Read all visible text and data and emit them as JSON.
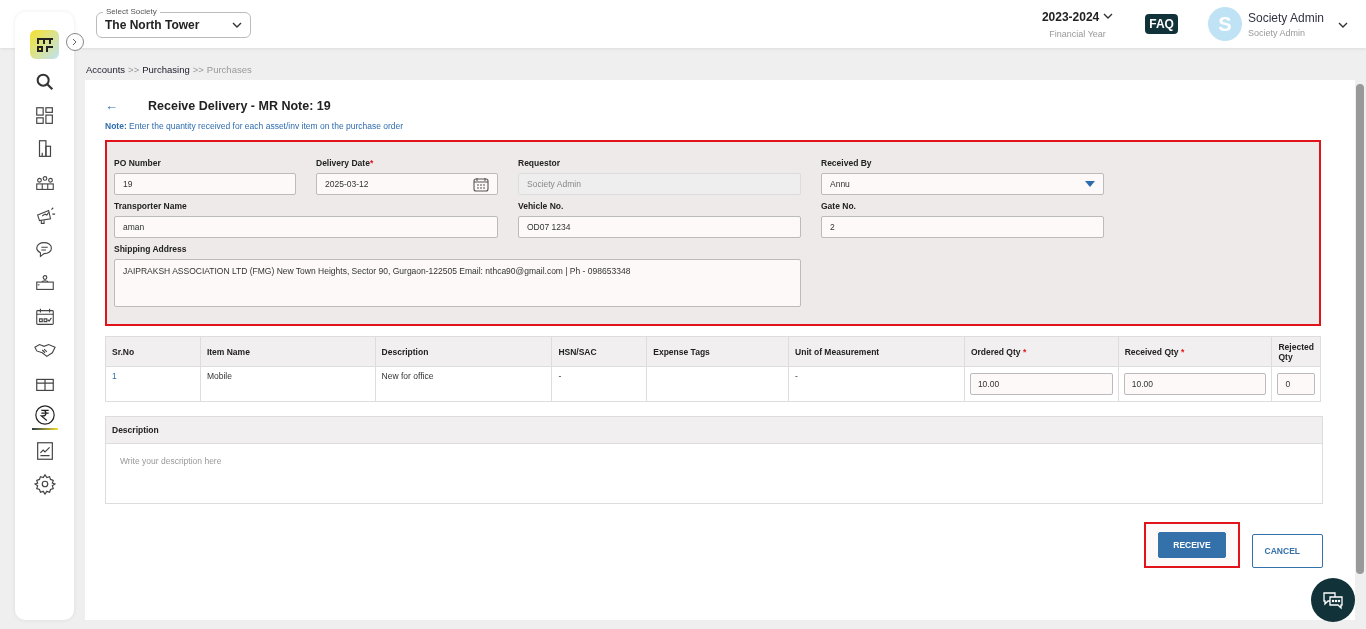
{
  "top_bar": {
    "society_select": {
      "label": "Select Society",
      "value": "The North Tower"
    },
    "financial_year": {
      "value": "2023-2024",
      "caption": "Financial Year"
    },
    "faq": "FAQ",
    "user": {
      "initial": "S",
      "name": "Society Admin",
      "role": "Society Admin"
    }
  },
  "sidebar": {
    "items": [
      {
        "selected": false
      },
      {
        "selected": false
      },
      {
        "selected": false
      },
      {
        "selected": false
      },
      {
        "selected": false
      },
      {
        "selected": false
      },
      {
        "selected": false
      },
      {
        "selected": false
      },
      {
        "selected": false
      },
      {
        "selected": false
      },
      {
        "selected": true
      },
      {
        "selected": false
      },
      {
        "selected": false
      }
    ]
  },
  "breadcrumb": [
    {
      "label": "Accounts",
      "current": false
    },
    {
      "label": "Purchasing",
      "current": false
    },
    {
      "label": "Purchases",
      "current": true
    }
  ],
  "breadcrumb_separator": ">>",
  "page": {
    "back": "←",
    "title": "Receive Delivery - MR Note: 19",
    "note_label": "Note:",
    "note": "Enter the quantity received for each asset/inv item on the purchase order"
  },
  "form": {
    "fields": [
      {
        "label": "PO Number",
        "value": "19",
        "required": false,
        "disabled": false,
        "kind": "text"
      },
      {
        "label": "Delivery Date",
        "value": "2025-03-12",
        "required": true,
        "disabled": false,
        "kind": "date"
      },
      {
        "label": "Requestor",
        "value": "Society Admin",
        "required": false,
        "disabled": true,
        "kind": "text"
      },
      {
        "label": "Received By",
        "value": "Annu",
        "required": false,
        "disabled": false,
        "kind": "select"
      },
      {
        "label": "Transporter Name",
        "value": "aman",
        "required": false,
        "disabled": false,
        "kind": "text"
      },
      {
        "label": "Vehicle No.",
        "value": "OD07 1234",
        "required": false,
        "disabled": false,
        "kind": "text"
      },
      {
        "label": "Gate No.",
        "value": "2",
        "required": false,
        "disabled": false,
        "kind": "text"
      },
      {
        "label": "Shipping Address",
        "value": "JAIPRAKSH ASSOCIATION LTD (FMG) New Town Heights, Sector 90, Gurgaon-122505  Email: nthca90@gmail.com | Ph - 098653348",
        "required": false,
        "disabled": false,
        "kind": "textarea"
      }
    ]
  },
  "required_mark": "*",
  "table": {
    "columns": [
      {
        "label": "Sr.No",
        "required": false
      },
      {
        "label": "Item Name",
        "required": false
      },
      {
        "label": "Description",
        "required": false
      },
      {
        "label": "HSN/SAC",
        "required": false
      },
      {
        "label": "Expense Tags",
        "required": false
      },
      {
        "label": "Unit of Measurement",
        "required": false
      },
      {
        "label": "Ordered Qty",
        "required": true
      },
      {
        "label": "Received Qty",
        "required": true
      },
      {
        "label": "Rejected Qty",
        "required": false
      }
    ],
    "rows": [
      {
        "cells": [
          {
            "kind": "link",
            "value": "1"
          },
          {
            "kind": "text",
            "value": "Mobile"
          },
          {
            "kind": "text",
            "value": "New for office"
          },
          {
            "kind": "text",
            "value": "-"
          },
          {
            "kind": "empty"
          },
          {
            "kind": "text",
            "value": "-"
          },
          {
            "kind": "input",
            "value": "10.00"
          },
          {
            "kind": "input",
            "value": "10.00"
          },
          {
            "kind": "input",
            "value": "0"
          }
        ]
      }
    ]
  },
  "description": {
    "label": "Description",
    "placeholder": "Write your description here"
  },
  "buttons": [
    {
      "label": "RECEIVE",
      "kind": "primary"
    },
    {
      "label": "CANCEL",
      "kind": "secondary"
    }
  ]
}
